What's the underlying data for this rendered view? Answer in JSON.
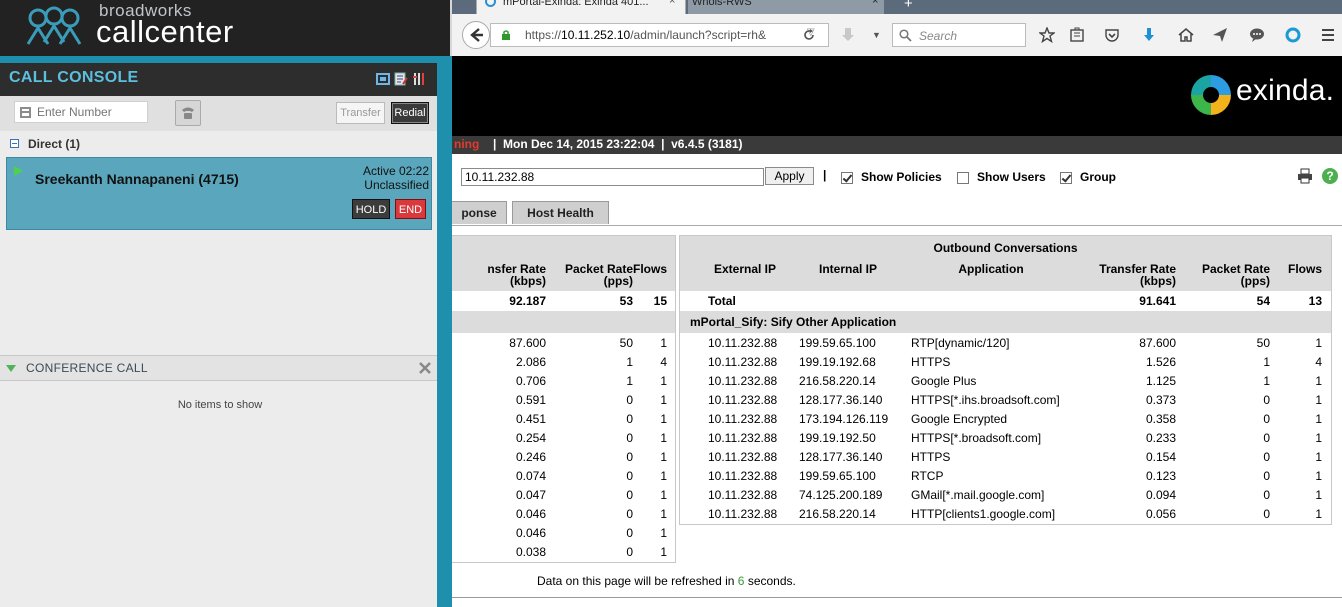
{
  "callcenter": {
    "brand": "broadworks",
    "product": "callcenter",
    "console_title": "CALL CONSOLE",
    "number_placeholder": "Enter Number",
    "transfer_label": "Transfer",
    "redial_label": "Redial",
    "direct_group": "Direct (1)",
    "call": {
      "caller": "Sreekanth Nannapaneni (4715)",
      "status": "Active 02:22",
      "classification": "Unclassified",
      "hold_label": "HOLD",
      "end_label": "END"
    },
    "conference_title": "CONFERENCE CALL",
    "conference_empty": "No items to show"
  },
  "browser": {
    "tabs": [
      {
        "label": "mPortal-Exinda: Exinda 401..."
      },
      {
        "label": "Whois-RWS"
      }
    ],
    "url_prefix": "https://",
    "url_host": "10.11.252.10",
    "url_path": "/admin/launch?script=rh&",
    "search_placeholder": "Search",
    "icons": [
      "back-icon",
      "lock-icon",
      "reload-icon",
      "download-icon",
      "search-icon",
      "star-icon",
      "reading-list-icon",
      "pocket-icon",
      "downloads-icon",
      "home-icon",
      "send-icon",
      "chat-icon",
      "ring-icon",
      "menu-icon"
    ]
  },
  "exinda": {
    "brand": "exinda.",
    "status_warning": "ning",
    "status_text": "|  Mon Dec 14, 2015 23:22:04  |  v6.4.5 (3181)",
    "filter_ip": "10.11.232.88",
    "apply_label": "Apply",
    "show_policies_label": "Show Policies",
    "show_policies_checked": true,
    "show_users_label": "Show Users",
    "show_users_checked": false,
    "group_label": "Group",
    "group_checked": true,
    "tabs": [
      "ponse",
      "Host Health"
    ],
    "inbound": {
      "headers": [
        "nsfer Rate\n(kbps)",
        "Packet Rate\n(pps)",
        "Flows"
      ],
      "total": [
        "92.187",
        "53",
        "15"
      ],
      "rows": [
        [
          "87.600",
          "50",
          "1"
        ],
        [
          "2.086",
          "1",
          "4"
        ],
        [
          "0.706",
          "1",
          "1"
        ],
        [
          "0.591",
          "0",
          "1"
        ],
        [
          "0.451",
          "0",
          "1"
        ],
        [
          "0.254",
          "0",
          "1"
        ],
        [
          "0.246",
          "0",
          "1"
        ],
        [
          "0.074",
          "0",
          "1"
        ],
        [
          "0.047",
          "0",
          "1"
        ],
        [
          "0.046",
          "0",
          "1"
        ],
        [
          "0.046",
          "0",
          "1"
        ],
        [
          "0.038",
          "0",
          "1"
        ]
      ]
    },
    "outbound": {
      "title": "Outbound Conversations",
      "headers": [
        "External IP",
        "Internal IP",
        "Application",
        "Transfer Rate\n(kbps)",
        "Packet Rate\n(pps)",
        "Flows"
      ],
      "total_label": "Total",
      "total": [
        "91.641",
        "54",
        "13"
      ],
      "group": "mPortal_Sify: Sify Other Application",
      "rows": [
        [
          "10.11.232.88",
          "199.59.65.100",
          "RTP[dynamic/120]",
          "87.600",
          "50",
          "1"
        ],
        [
          "10.11.232.88",
          "199.19.192.68",
          "HTTPS",
          "1.526",
          "1",
          "4"
        ],
        [
          "10.11.232.88",
          "216.58.220.14",
          "Google Plus",
          "1.125",
          "1",
          "1"
        ],
        [
          "10.11.232.88",
          "128.177.36.140",
          "HTTPS[*.ihs.broadsoft.com]",
          "0.373",
          "0",
          "1"
        ],
        [
          "10.11.232.88",
          "173.194.126.119",
          "Google Encrypted",
          "0.358",
          "0",
          "1"
        ],
        [
          "10.11.232.88",
          "199.19.192.50",
          "HTTPS[*.broadsoft.com]",
          "0.233",
          "0",
          "1"
        ],
        [
          "10.11.232.88",
          "128.177.36.140",
          "HTTPS",
          "0.154",
          "0",
          "1"
        ],
        [
          "10.11.232.88",
          "199.59.65.100",
          "RTCP",
          "0.123",
          "0",
          "1"
        ],
        [
          "10.11.232.88",
          "74.125.200.189",
          "GMail[*.mail.google.com]",
          "0.094",
          "0",
          "1"
        ],
        [
          "10.11.232.88",
          "216.58.220.14",
          "HTTP[clients1.google.com]",
          "0.056",
          "0",
          "1"
        ]
      ]
    },
    "refresh_prefix": "Data on this page will be refreshed in ",
    "refresh_seconds": "6",
    "refresh_suffix": " seconds."
  }
}
